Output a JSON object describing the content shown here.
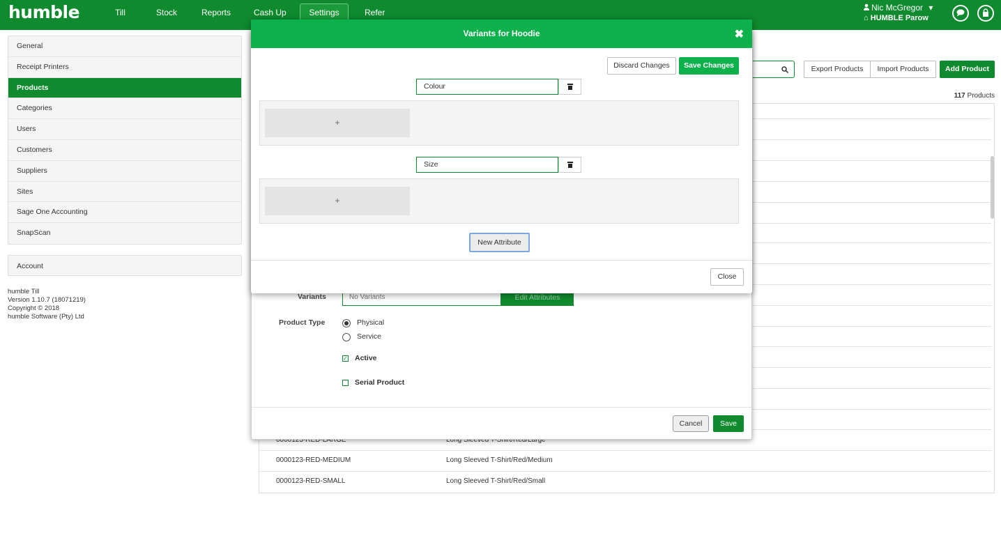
{
  "topbar": {
    "logo": "humble",
    "nav": [
      {
        "label": "Till"
      },
      {
        "label": "Stock"
      },
      {
        "label": "Reports"
      },
      {
        "label": "Cash Up"
      },
      {
        "label": "Settings"
      },
      {
        "label": "Refer"
      }
    ],
    "user_name": "Nic McGregor",
    "user_site": "HUMBLE Parow",
    "caret": "▾",
    "home_glyph": "⌂"
  },
  "sidebar": {
    "items": [
      {
        "label": "General"
      },
      {
        "label": "Receipt Printers"
      },
      {
        "label": "Products"
      },
      {
        "label": "Categories"
      },
      {
        "label": "Users"
      },
      {
        "label": "Customers"
      },
      {
        "label": "Suppliers"
      },
      {
        "label": "Sites"
      },
      {
        "label": "Sage One Accounting"
      },
      {
        "label": "SnapScan"
      }
    ],
    "account": "Account",
    "version_lines": [
      "humble Till",
      "Version 1.10.7 (18071219)",
      "Copyright © 2018",
      "humble Software (Pty) Ltd"
    ]
  },
  "products_page": {
    "search_icon": "⚲",
    "export_label": "Export Products",
    "import_label": "Import Products",
    "add_label": "Add Product",
    "count": "117",
    "count_suffix": "Products",
    "rows": [
      {
        "sku": "0000123-RED-LARGE",
        "name": "Long Sleeved T-Shirt/Red/Large"
      },
      {
        "sku": "0000123-RED-MEDIUM",
        "name": "Long Sleeved T-Shirt/Red/Medium"
      },
      {
        "sku": "0000123-RED-SMALL",
        "name": "Long Sleeved T-Shirt/Red/Small"
      }
    ]
  },
  "edit_product": {
    "variants_label": "Variants",
    "variants_value": "No Variants",
    "edit_attributes_label": "Edit Attributes",
    "product_type_label": "Product Type",
    "type_physical": "Physical",
    "type_service": "Service",
    "active_label": "Active",
    "serial_label": "Serial Product",
    "check_glyph": "✓",
    "cancel_label": "Cancel",
    "save_label": "Save"
  },
  "variants_dialog": {
    "title": "Variants for Hoodie",
    "close_glyph": "✖",
    "discard_label": "Discard Changes",
    "save_label": "Save Changes",
    "attributes": [
      {
        "name": "Colour",
        "add_glyph": "+"
      },
      {
        "name": "Size",
        "add_glyph": "+"
      }
    ],
    "new_attribute_label": "New Attribute",
    "close_label": "Close"
  }
}
